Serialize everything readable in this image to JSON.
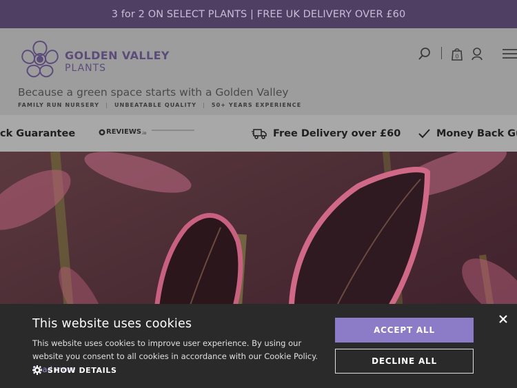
{
  "banner": {
    "text": "3 for 2 ON SELECT PLANTS | FREE UK DELIVERY OVER £60"
  },
  "brand": {
    "line1": "GOLDEN VALLEY",
    "line2": "PLANTS"
  },
  "header": {
    "tagline": "Because a green space starts with a Golden Valley",
    "subtags": [
      "FAMILY RUN NURSERY",
      "UNBEATABLE QUALITY",
      "50+ YEARS EXPERIENCE"
    ],
    "icons": [
      "search-icon",
      "bag-icon",
      "account-icon",
      "menu-icon"
    ],
    "cart_count": "0"
  },
  "usp": {
    "left_partial": "ck Guarantee",
    "reviews_brand": "REVIEWS",
    "reviews_suffix": ".io",
    "delivery": "Free Delivery over £60",
    "money_back": "Money Back Gua"
  },
  "cookie": {
    "title": "This website uses cookies",
    "body": "This website uses cookies to improve user experience. By using our website you consent to all cookies in accordance with our Cookie Policy.",
    "read_more": "Read more",
    "show_details": "SHOW DETAILS",
    "accept": "ACCEPT ALL",
    "decline": "DECLINE ALL"
  },
  "colors": {
    "banner_bg": "#4e3f63",
    "brand_purple": "#5c4c7a",
    "accept_bg": "#8c7bc6",
    "cookie_bg": "#2a2a2a"
  }
}
